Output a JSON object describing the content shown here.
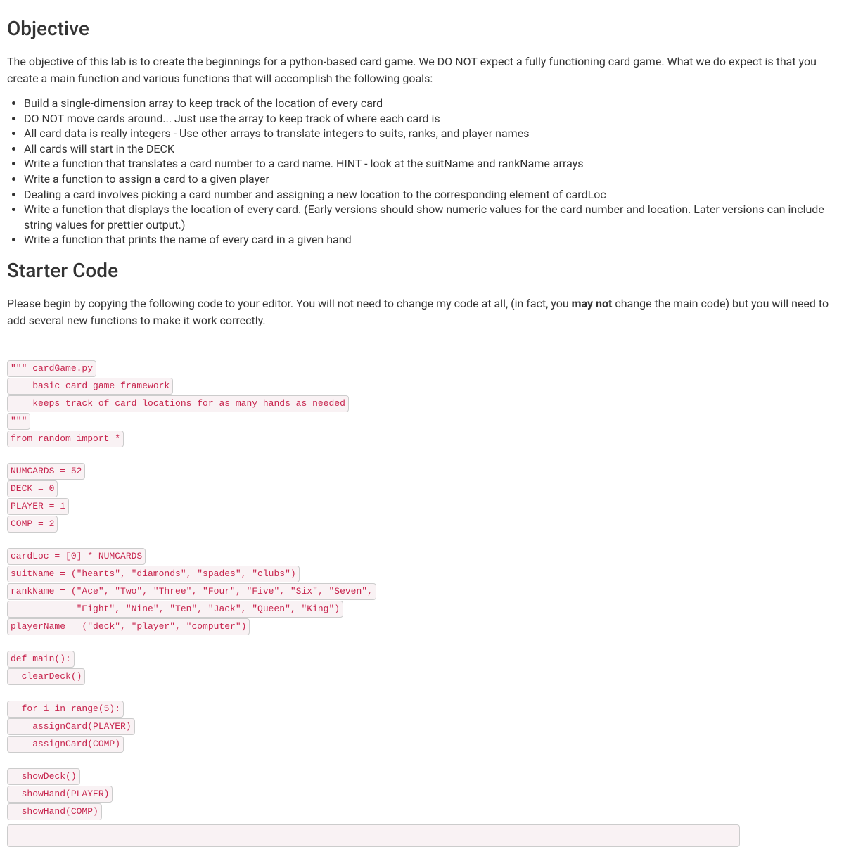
{
  "headings": {
    "objective": "Objective",
    "starter_code": "Starter Code"
  },
  "intro": "The objective of this lab is to create the beginnings for a python-based card game. We DO NOT expect a fully functioning card game. What we do expect is that you create a main function and various functions that will accomplish the following goals:",
  "goals": [
    "Build a single-dimension array to keep track of the location of every card",
    "DO NOT move cards around... Just use the array to keep track of where each card is",
    "All card data is really integers - Use other arrays to translate integers to suits, ranks, and player names",
    "All cards will start in the DECK",
    "Write a function that translates a card number to a card name. HINT - look at the suitName and rankName arrays",
    "Write a function to assign a card to a given player",
    "Dealing a card involves picking a card number and assigning a new location to the corresponding element of cardLoc",
    "Write a function that displays the location of every card. (Early versions should show numeric values for the card number and location. Later versions can include string values for prettier output.)",
    "Write a function that prints the name of every card in a given hand"
  ],
  "starter_para": {
    "prefix": "Please begin by copying the following code to your editor. You will not need to change my code at all, (in fact, you ",
    "bold": "may not",
    "suffix": " change the main code) but you will need to add several new functions to make it work correctly."
  },
  "code_lines": [
    "\"\"\" cardGame.py",
    "    basic card game framework",
    "    keeps track of card locations for as many hands as needed",
    "\"\"\"",
    "from random import *",
    "",
    "NUMCARDS = 52",
    "DECK = 0",
    "PLAYER = 1",
    "COMP = 2",
    "",
    "cardLoc = [0] * NUMCARDS",
    "suitName = (\"hearts\", \"diamonds\", \"spades\", \"clubs\")",
    "rankName = (\"Ace\", \"Two\", \"Three\", \"Four\", \"Five\", \"Six\", \"Seven\",",
    "            \"Eight\", \"Nine\", \"Ten\", \"Jack\", \"Queen\", \"King\")",
    "playerName = (\"deck\", \"player\", \"computer\")",
    "",
    "def main():",
    "  clearDeck()",
    "",
    "  for i in range(5):",
    "    assignCard(PLAYER)",
    "    assignCard(COMP)",
    "",
    "  showDeck()",
    "  showHand(PLAYER)",
    "  showHand(COMP)"
  ]
}
